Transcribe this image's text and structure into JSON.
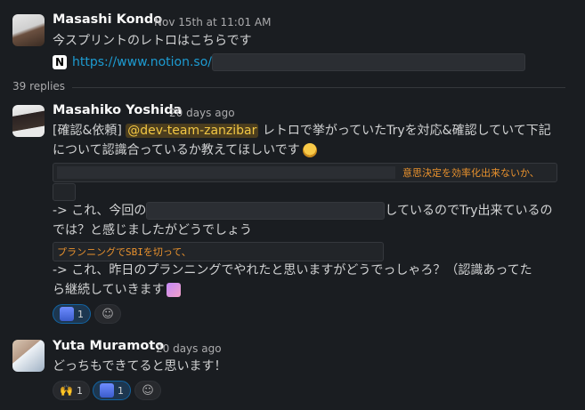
{
  "parent": {
    "author": "Masashi Kondo",
    "time": "Nov 15th at 11:01 AM",
    "text": "今スプリントのレトロはこちらです",
    "link_text": "https://www.notion.so/"
  },
  "thread": {
    "replies_label": "39 replies"
  },
  "reply1": {
    "author": "Masahiko Yoshida",
    "time": "20 days ago",
    "line1_prefix": "[確認&依頼]",
    "mention": "@dev-team-zanzibar",
    "line1_suffix": "レトロで挙がっていたTryを対応&確認していて下記",
    "line2": "について認識合っているか教えてほしいです",
    "quote1": "意思決定を効率化出来ないか、",
    "line3_prefix": "-> これ、今回の",
    "line3_suffix": "しているのでTry出来ているの",
    "line4": "では？と感じましたがどうでしょう",
    "quote2": "プランニングでSBIを切って、",
    "line5": "-> これ、昨日のプランニングでやれたと思いますがどうでっしゃろ？（認識あってた",
    "line6": "ら継続していきます",
    "reaction_count": "1"
  },
  "reply2": {
    "author": "Yuta Muramoto",
    "time": "20 days ago",
    "text": "どっちもできてると思います！",
    "reaction1_emoji": "🙌",
    "reaction1_count": "1",
    "reaction2_count": "1"
  },
  "icons": [
    "notion-icon",
    "add-reaction-icon",
    "raised-hands-icon",
    "bow-emoji-icon",
    "sparkle-emoji-icon"
  ]
}
